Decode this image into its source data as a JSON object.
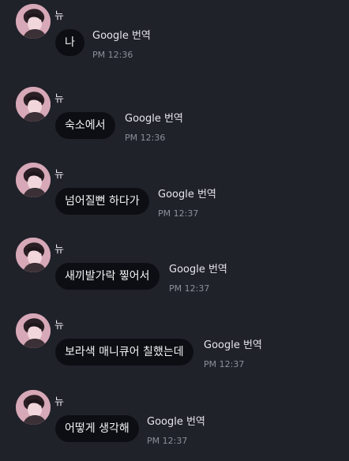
{
  "chat": {
    "messages": [
      {
        "sender": "뉴",
        "text": "나",
        "translator": "Google 번역",
        "time": "PM 12:36"
      },
      {
        "sender": "뉴",
        "text": "숙소에서",
        "translator": "Google 번역",
        "time": "PM 12:36"
      },
      {
        "sender": "뉴",
        "text": "넘어질뻔 하다가",
        "translator": "Google 번역",
        "time": "PM 12:37"
      },
      {
        "sender": "뉴",
        "text": "새끼발가락 찧어서",
        "translator": "Google 번역",
        "time": "PM 12:37"
      },
      {
        "sender": "뉴",
        "text": "보라색 매니큐어 칠했는데",
        "translator": "Google 번역",
        "time": "PM 12:37"
      },
      {
        "sender": "뉴",
        "text": "어떻게 생각해",
        "translator": "Google 번역",
        "time": "PM 12:37"
      }
    ]
  },
  "colors": {
    "background": "#20222a",
    "bubble": "#0d0e13",
    "avatar_pink": "#d7a8b7",
    "muted_text": "#8d8f99"
  },
  "icons": {
    "avatar": "profile-photo"
  }
}
